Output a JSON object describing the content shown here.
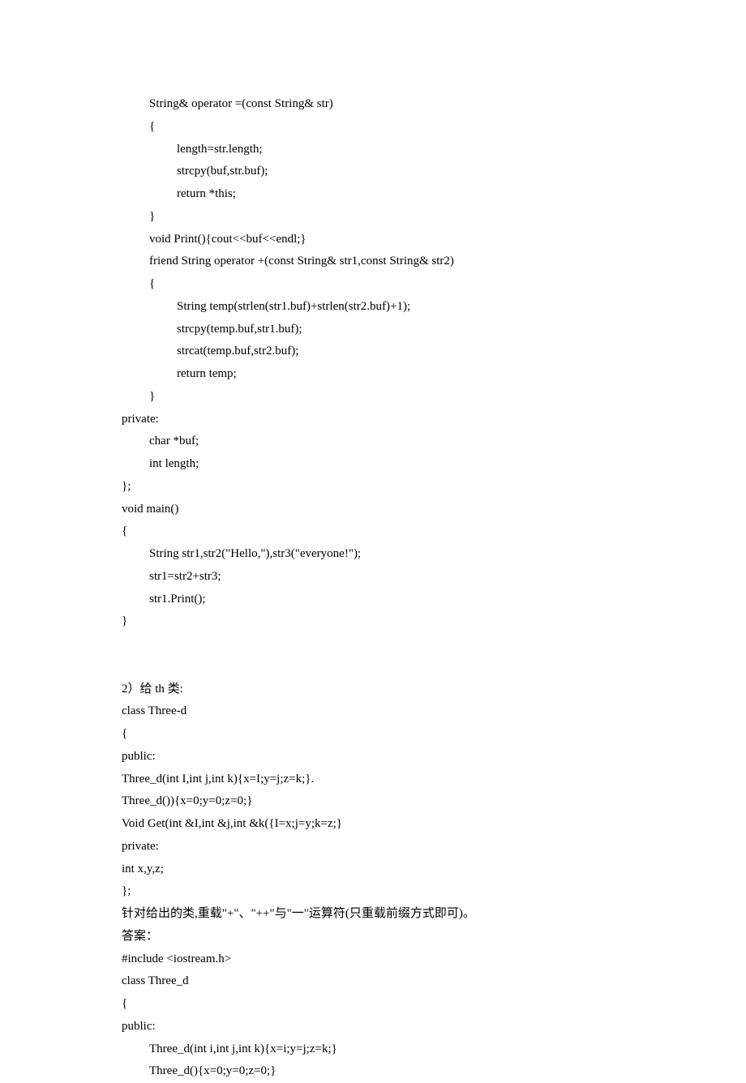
{
  "lines": [
    {
      "indent": 1,
      "text": "String& operator =(const String& str)"
    },
    {
      "indent": 1,
      "text": "{"
    },
    {
      "indent": 2,
      "text": "length=str.length;"
    },
    {
      "indent": 2,
      "text": "strcpy(buf,str.buf);"
    },
    {
      "indent": 2,
      "text": "return *this;"
    },
    {
      "indent": 1,
      "text": "}"
    },
    {
      "indent": 1,
      "text": "void Print(){cout<<buf<<endl;}"
    },
    {
      "indent": 1,
      "text": "friend String operator +(const String& str1,const String& str2)"
    },
    {
      "indent": 1,
      "text": "{"
    },
    {
      "indent": 2,
      "text": "String temp(strlen(str1.buf)+strlen(str2.buf)+1);"
    },
    {
      "indent": 2,
      "text": "strcpy(temp.buf,str1.buf);"
    },
    {
      "indent": 2,
      "text": "strcat(temp.buf,str2.buf);"
    },
    {
      "indent": 2,
      "text": "return temp;"
    },
    {
      "indent": 1,
      "text": "}"
    },
    {
      "indent": 0,
      "text": "private:"
    },
    {
      "indent": 1,
      "text": "char *buf;"
    },
    {
      "indent": 1,
      "text": "int length;"
    },
    {
      "indent": 0,
      "text": "};"
    },
    {
      "indent": 0,
      "text": "void main()"
    },
    {
      "indent": 0,
      "text": "{"
    },
    {
      "indent": 1,
      "text": "String str1,str2(\"Hello,\"),str3(\"everyone!\");"
    },
    {
      "indent": 1,
      "text": "str1=str2+str3;"
    },
    {
      "indent": 1,
      "text": "str1.Print();"
    },
    {
      "indent": 0,
      "text": "}"
    },
    {
      "indent": 0,
      "text": ""
    },
    {
      "indent": 0,
      "text": ""
    },
    {
      "indent": 0,
      "text": "2）给 th 类:"
    },
    {
      "indent": 0,
      "text": "class Three-d"
    },
    {
      "indent": 0,
      "text": "{"
    },
    {
      "indent": 0,
      "text": "public:"
    },
    {
      "indent": 0,
      "text": "Three_d(int I,int j,int k){x=I;y=j;z=k;}."
    },
    {
      "indent": 0,
      "text": "Three_d()){x=0;y=0;z=0;}"
    },
    {
      "indent": 0,
      "text": "Void Get(int &I,int &j,int &k({I=x;j=y;k=z;}"
    },
    {
      "indent": 0,
      "text": "private:"
    },
    {
      "indent": 0,
      "text": "int x,y,z;"
    },
    {
      "indent": 0,
      "text": "};"
    },
    {
      "indent": 0,
      "text": "针对给出的类,重载\"+\"、\"++\"与\"一\"运算符(只重载前缀方式即可)。"
    },
    {
      "indent": 0,
      "text": "答案："
    },
    {
      "indent": 0,
      "text": "#include <iostream.h>"
    },
    {
      "indent": 0,
      "text": "class Three_d"
    },
    {
      "indent": 0,
      "text": "{"
    },
    {
      "indent": 0,
      "text": "public:"
    },
    {
      "indent": 1,
      "text": "Three_d(int i,int j,int k){x=i;y=j;z=k;}"
    },
    {
      "indent": 1,
      "text": "Three_d(){x=0;y=0;z=0;}"
    }
  ]
}
